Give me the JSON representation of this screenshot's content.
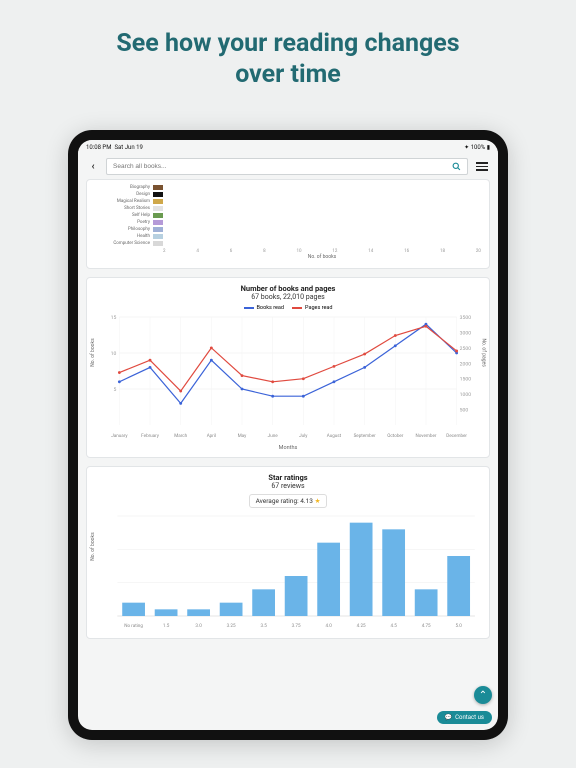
{
  "hero": {
    "line1": "See how your reading changes",
    "line2": "over time"
  },
  "status": {
    "time": "10:08 PM",
    "date": "Sat Jun 19",
    "battery": "100%"
  },
  "search": {
    "placeholder": "Search all books..."
  },
  "colors": {
    "accent": "#1a8b97",
    "red": "#e04a3f",
    "blue": "#3b63d8",
    "barBlue": "#6ab4e8",
    "star": "#f3b61f"
  },
  "genre_chart": {
    "xlabel": "No. of books",
    "x_ticks": [
      2,
      4,
      6,
      8,
      10,
      12,
      14,
      16,
      18,
      20
    ],
    "items": [
      {
        "label": "Biography",
        "color": "#7a5230"
      },
      {
        "label": "Design",
        "color": "#111111"
      },
      {
        "label": "Magical Realism",
        "color": "#cfa84a"
      },
      {
        "label": "Short Stories",
        "color": "#e3e3e3"
      },
      {
        "label": "Self Help",
        "color": "#6a9b50"
      },
      {
        "label": "Poetry",
        "color": "#b59ad8"
      },
      {
        "label": "Philosophy",
        "color": "#9fb0d6"
      },
      {
        "label": "Health",
        "color": "#b7d0e0"
      },
      {
        "label": "Computer Science",
        "color": "#d8d8d8"
      }
    ]
  },
  "chart_data": [
    {
      "type": "line",
      "title": "Number of books and pages",
      "subtitle": "67 books, 22,010 pages",
      "xlabel": "Months",
      "ylabel_left": "No. of books",
      "ylabel_right": "No. of pages",
      "x": [
        "January",
        "February",
        "March",
        "April",
        "May",
        "June",
        "July",
        "August",
        "September",
        "October",
        "November",
        "December"
      ],
      "y_left_ticks": [
        5,
        10,
        15
      ],
      "y_right_ticks": [
        500,
        1000,
        1500,
        2000,
        2500,
        3000,
        3500
      ],
      "series": [
        {
          "name": "Books read",
          "color": "#3b63d8",
          "axis": "left",
          "values": [
            6,
            8,
            3,
            9,
            5,
            4,
            4,
            6,
            8,
            11,
            14,
            10
          ]
        },
        {
          "name": "Pages read",
          "color": "#e04a3f",
          "axis": "right",
          "values": [
            1700,
            2100,
            1100,
            2500,
            1600,
            1400,
            1500,
            1900,
            2300,
            2900,
            3200,
            2400
          ]
        }
      ]
    },
    {
      "type": "bar",
      "title": "Star ratings",
      "subtitle": "67 reviews",
      "average_label": "Average rating: 4.13",
      "ylabel": "No. of books",
      "categories": [
        "No rating",
        "1.5",
        "3.0",
        "3.25",
        "3.5",
        "3.75",
        "4.0",
        "4.25",
        "4.5",
        "4.75",
        "5.0"
      ],
      "values": [
        2,
        1,
        1,
        2,
        4,
        6,
        11,
        14,
        13,
        4,
        9
      ],
      "ylim": [
        0,
        15
      ],
      "color": "#6ab4e8"
    }
  ],
  "fab": {
    "contact": "Contact us"
  }
}
